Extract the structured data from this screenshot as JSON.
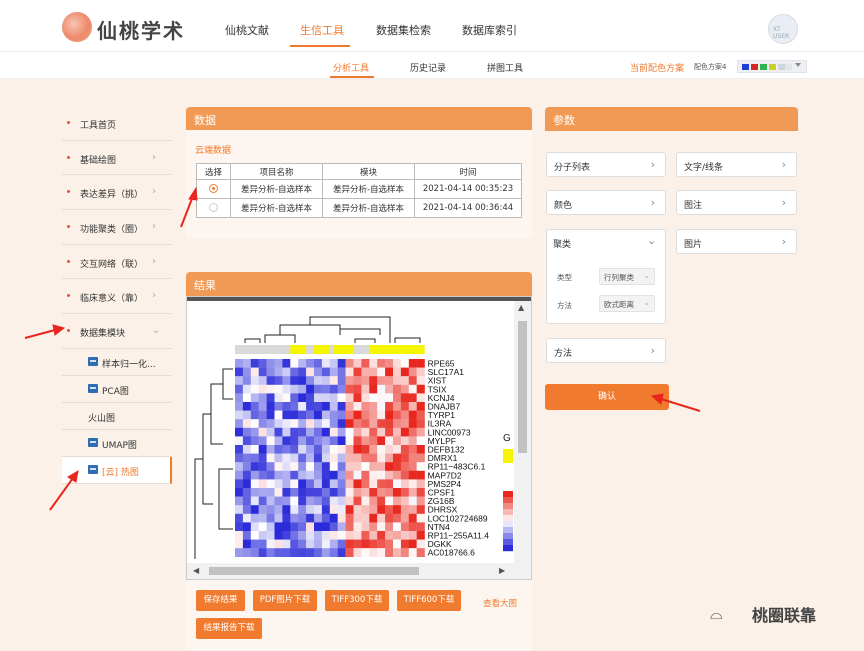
{
  "header": {
    "logo_text": "仙桃学术",
    "nav": [
      {
        "label": "仙桃文献",
        "active": false
      },
      {
        "label": "生信工具",
        "active": true
      },
      {
        "label": "数据集检索",
        "active": false
      },
      {
        "label": "数据库索引",
        "active": false
      }
    ],
    "avatar_text": "XT USER"
  },
  "subnav": {
    "items": [
      {
        "label": "分析工具",
        "active": true
      },
      {
        "label": "历史记录",
        "active": false
      },
      {
        "label": "拼图工具",
        "active": false
      }
    ],
    "scheme_link": "当前配色方案",
    "scheme_label": "配色方案4",
    "scheme_colors": [
      "#1f3fd6",
      "#d62727",
      "#2bb54a",
      "#c8d12c",
      "#cfd5dc",
      "#e2e6ea"
    ]
  },
  "sidebar": {
    "items": [
      {
        "label": "工具首页",
        "chevron": ""
      },
      {
        "label": "基础绘图",
        "chevron": "›"
      },
      {
        "label": "表达差异（挑）",
        "chevron": "›"
      },
      {
        "label": "功能聚类（圈）",
        "chevron": "›"
      },
      {
        "label": "交互网络（联）",
        "chevron": "›"
      },
      {
        "label": "临床意义（靠）",
        "chevron": "›"
      },
      {
        "label": "数据集模块",
        "chevron": "⌄"
      }
    ],
    "subitems": [
      {
        "label": "样本归一化...",
        "icon": true
      },
      {
        "label": "PCA图",
        "icon": true
      },
      {
        "label": "火山图",
        "icon": false
      },
      {
        "label": "UMAP图",
        "icon": true
      },
      {
        "label": "[云] 热图",
        "icon": true
      }
    ]
  },
  "data_panel": {
    "title": "数据",
    "cloud_link": "云端数据",
    "headers": [
      "选择",
      "项目名称",
      "模块",
      "时间"
    ],
    "rows": [
      {
        "selected": true,
        "name": "差异分析-自选样本",
        "module": "差异分析-自选样本",
        "time": "2021-04-14 00:35:23"
      },
      {
        "selected": false,
        "name": "差异分析-自选样本",
        "module": "差异分析-自选样本",
        "time": "2021-04-14 00:36:44"
      }
    ]
  },
  "result_panel": {
    "title": "结果",
    "genes": [
      "RPE65",
      "SLC17A1",
      "XIST",
      "TSIX",
      "KCNJ4",
      "DNAJB7",
      "TYRP1",
      "IL3RA",
      "LINC00973",
      "MYLPF",
      "DEFB132",
      "DMRX1",
      "RP11−483C6.1",
      "MAP7D2",
      "PMS2P4",
      "CPSF1",
      "ZG16B",
      "DHRSX",
      "LOC102724689",
      "NTN4",
      "RP11−255A11.4",
      "DGKK",
      "AC018766.6"
    ],
    "legend_letter": "G",
    "buttons": [
      "保存结果",
      "PDF图片下载",
      "TIFF300下载",
      "TIFF600下载",
      "结果报告下载"
    ],
    "view_big": "查看大图",
    "heatmap_colors": {
      "low": "#2b2bd9",
      "mid": "#ffffff",
      "high": "#e8281e",
      "group": "#f5f500"
    }
  },
  "param_panel": {
    "title": "参数",
    "left_items": [
      "分子列表",
      "颜色"
    ],
    "right_items": [
      "文字/线条",
      "图注",
      "图片"
    ],
    "cluster": {
      "label": "聚类",
      "type_label": "类型",
      "type_value": "行列聚类",
      "method_label": "方法",
      "method_value": "欧式距离"
    },
    "method_item": "方法",
    "confirm": "确认"
  },
  "watermark": "桃圈联靠"
}
